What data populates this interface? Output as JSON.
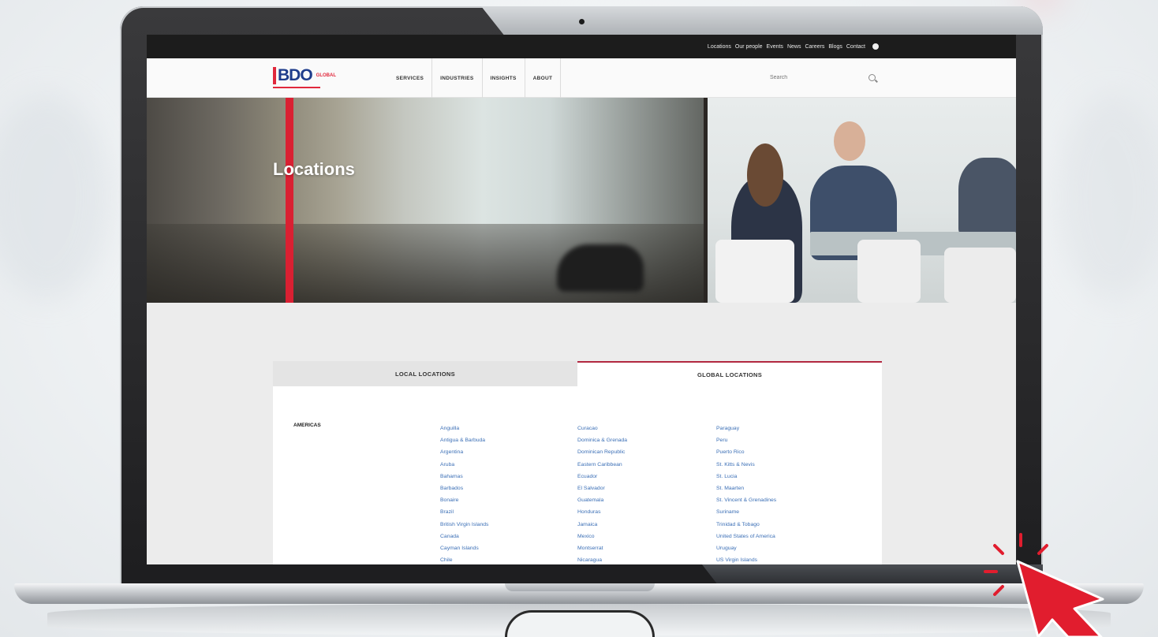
{
  "topbar": {
    "links": [
      "Locations",
      "Our people",
      "Events",
      "News",
      "Careers",
      "Blogs",
      "Contact"
    ]
  },
  "header": {
    "logo_text": "BDO",
    "logo_sub": "GLOBAL",
    "nav": [
      "SERVICES",
      "INDUSTRIES",
      "INSIGHTS",
      "ABOUT"
    ],
    "search_placeholder": "Search"
  },
  "hero": {
    "title": "Locations"
  },
  "tabs": {
    "local": "LOCAL LOCATIONS",
    "global": "GLOBAL LOCATIONS"
  },
  "region": "AMERICAS",
  "countries": {
    "col1": [
      "Anguilla",
      "Antigua & Barbuda",
      "Argentina",
      "Aruba",
      "Bahamas",
      "Barbados",
      "Bonaire",
      "Brazil",
      "British Virgin Islands",
      "Canada",
      "Cayman Islands",
      "Chile"
    ],
    "col2": [
      "Curacao",
      "Dominica & Grenada",
      "Dominican Republic",
      "Eastern Caribbean",
      "Ecuador",
      "El Salvador",
      "Guatemala",
      "Honduras",
      "Jamaica",
      "Mexico",
      "Montserrat",
      "Nicaragua"
    ],
    "col3": [
      "Paraguay",
      "Peru",
      "Puerto Rico",
      "St. Kitts & Nevis",
      "St. Lucia",
      "St. Maarten",
      "St. Vincent & Grenadines",
      "Suriname",
      "Trinidad & Tobago",
      "United States of America",
      "Uruguay",
      "US Virgin Islands"
    ]
  },
  "colors": {
    "brand_blue": "#1f3d8c",
    "brand_red": "#e0283c",
    "link_blue": "#3b6fb6",
    "cursor_red": "#e11d2e"
  }
}
